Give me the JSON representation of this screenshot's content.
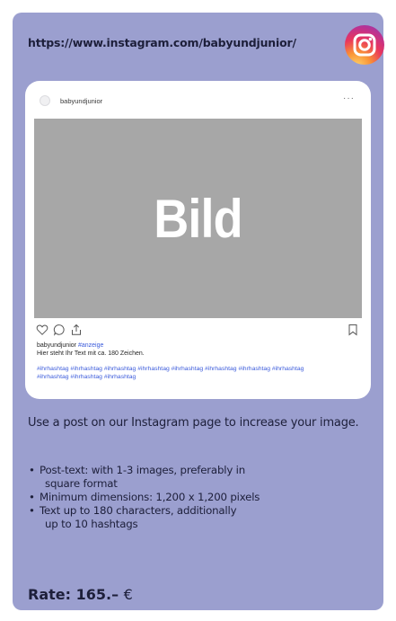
{
  "colors": {
    "card_bg": "#9b9fcf",
    "text": "#1d1f3a",
    "image_placeholder": "#a7a7a7",
    "hashtag": "#3b5bdb"
  },
  "header": {
    "url": "https://www.instagram.com/babyundjunior/",
    "logo_icon": "instagram-logo-icon"
  },
  "post": {
    "username": "babyundjunior",
    "more_icon": "ellipsis-icon",
    "more_label": "···",
    "image_label": "Bild",
    "actions": [
      "heart-icon",
      "comment-icon",
      "share-icon",
      "bookmark-icon"
    ],
    "caption_user": "babyundjunior",
    "caption_tag": "#anzeige",
    "caption_text": "Hier steht Ihr Text mit ca. 180 Zeichen.",
    "hashtags_line1": "#ihrhashtag #ihrhashtag #ihrhashtag #ihrhashtag #ihrhashtag #ihrhashtag #ihrhashtag #ihrhashtag",
    "hashtags_line2": "#ihrhashtag #ihrhashtag #ihrhashtag"
  },
  "description": "Use a post on our Instagram page to increase your image.",
  "bullets": [
    {
      "line1": "Post-text: with 1-3 images, preferably in",
      "line2": "square format"
    },
    {
      "line1": "Minimum dimensions: 1,200 x 1,200 pixels",
      "line2": ""
    },
    {
      "line1": "Text up to 180 characters, additionally",
      "line2": "up to 10 hashtags"
    }
  ],
  "bullet_symbol": "•",
  "rate": {
    "label": "Rate: 165.–",
    "currency": "€"
  }
}
